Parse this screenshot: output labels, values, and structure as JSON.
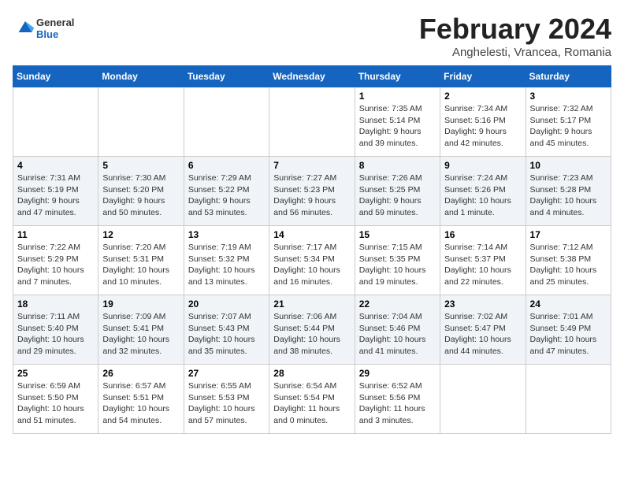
{
  "header": {
    "logo_general": "General",
    "logo_blue": "Blue",
    "title": "February 2024",
    "subtitle": "Anghelesti, Vrancea, Romania"
  },
  "columns": [
    "Sunday",
    "Monday",
    "Tuesday",
    "Wednesday",
    "Thursday",
    "Friday",
    "Saturday"
  ],
  "weeks": [
    {
      "days": [
        {
          "num": "",
          "info": ""
        },
        {
          "num": "",
          "info": ""
        },
        {
          "num": "",
          "info": ""
        },
        {
          "num": "",
          "info": ""
        },
        {
          "num": "1",
          "info": "Sunrise: 7:35 AM\nSunset: 5:14 PM\nDaylight: 9 hours\nand 39 minutes."
        },
        {
          "num": "2",
          "info": "Sunrise: 7:34 AM\nSunset: 5:16 PM\nDaylight: 9 hours\nand 42 minutes."
        },
        {
          "num": "3",
          "info": "Sunrise: 7:32 AM\nSunset: 5:17 PM\nDaylight: 9 hours\nand 45 minutes."
        }
      ]
    },
    {
      "days": [
        {
          "num": "4",
          "info": "Sunrise: 7:31 AM\nSunset: 5:19 PM\nDaylight: 9 hours\nand 47 minutes."
        },
        {
          "num": "5",
          "info": "Sunrise: 7:30 AM\nSunset: 5:20 PM\nDaylight: 9 hours\nand 50 minutes."
        },
        {
          "num": "6",
          "info": "Sunrise: 7:29 AM\nSunset: 5:22 PM\nDaylight: 9 hours\nand 53 minutes."
        },
        {
          "num": "7",
          "info": "Sunrise: 7:27 AM\nSunset: 5:23 PM\nDaylight: 9 hours\nand 56 minutes."
        },
        {
          "num": "8",
          "info": "Sunrise: 7:26 AM\nSunset: 5:25 PM\nDaylight: 9 hours\nand 59 minutes."
        },
        {
          "num": "9",
          "info": "Sunrise: 7:24 AM\nSunset: 5:26 PM\nDaylight: 10 hours\nand 1 minute."
        },
        {
          "num": "10",
          "info": "Sunrise: 7:23 AM\nSunset: 5:28 PM\nDaylight: 10 hours\nand 4 minutes."
        }
      ]
    },
    {
      "days": [
        {
          "num": "11",
          "info": "Sunrise: 7:22 AM\nSunset: 5:29 PM\nDaylight: 10 hours\nand 7 minutes."
        },
        {
          "num": "12",
          "info": "Sunrise: 7:20 AM\nSunset: 5:31 PM\nDaylight: 10 hours\nand 10 minutes."
        },
        {
          "num": "13",
          "info": "Sunrise: 7:19 AM\nSunset: 5:32 PM\nDaylight: 10 hours\nand 13 minutes."
        },
        {
          "num": "14",
          "info": "Sunrise: 7:17 AM\nSunset: 5:34 PM\nDaylight: 10 hours\nand 16 minutes."
        },
        {
          "num": "15",
          "info": "Sunrise: 7:15 AM\nSunset: 5:35 PM\nDaylight: 10 hours\nand 19 minutes."
        },
        {
          "num": "16",
          "info": "Sunrise: 7:14 AM\nSunset: 5:37 PM\nDaylight: 10 hours\nand 22 minutes."
        },
        {
          "num": "17",
          "info": "Sunrise: 7:12 AM\nSunset: 5:38 PM\nDaylight: 10 hours\nand 25 minutes."
        }
      ]
    },
    {
      "days": [
        {
          "num": "18",
          "info": "Sunrise: 7:11 AM\nSunset: 5:40 PM\nDaylight: 10 hours\nand 29 minutes."
        },
        {
          "num": "19",
          "info": "Sunrise: 7:09 AM\nSunset: 5:41 PM\nDaylight: 10 hours\nand 32 minutes."
        },
        {
          "num": "20",
          "info": "Sunrise: 7:07 AM\nSunset: 5:43 PM\nDaylight: 10 hours\nand 35 minutes."
        },
        {
          "num": "21",
          "info": "Sunrise: 7:06 AM\nSunset: 5:44 PM\nDaylight: 10 hours\nand 38 minutes."
        },
        {
          "num": "22",
          "info": "Sunrise: 7:04 AM\nSunset: 5:46 PM\nDaylight: 10 hours\nand 41 minutes."
        },
        {
          "num": "23",
          "info": "Sunrise: 7:02 AM\nSunset: 5:47 PM\nDaylight: 10 hours\nand 44 minutes."
        },
        {
          "num": "24",
          "info": "Sunrise: 7:01 AM\nSunset: 5:49 PM\nDaylight: 10 hours\nand 47 minutes."
        }
      ]
    },
    {
      "days": [
        {
          "num": "25",
          "info": "Sunrise: 6:59 AM\nSunset: 5:50 PM\nDaylight: 10 hours\nand 51 minutes."
        },
        {
          "num": "26",
          "info": "Sunrise: 6:57 AM\nSunset: 5:51 PM\nDaylight: 10 hours\nand 54 minutes."
        },
        {
          "num": "27",
          "info": "Sunrise: 6:55 AM\nSunset: 5:53 PM\nDaylight: 10 hours\nand 57 minutes."
        },
        {
          "num": "28",
          "info": "Sunrise: 6:54 AM\nSunset: 5:54 PM\nDaylight: 11 hours\nand 0 minutes."
        },
        {
          "num": "29",
          "info": "Sunrise: 6:52 AM\nSunset: 5:56 PM\nDaylight: 11 hours\nand 3 minutes."
        },
        {
          "num": "",
          "info": ""
        },
        {
          "num": "",
          "info": ""
        }
      ]
    }
  ]
}
